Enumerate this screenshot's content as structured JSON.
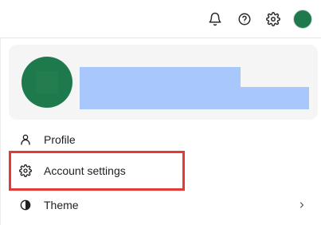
{
  "header": {
    "icons": [
      "bell-icon",
      "help-icon",
      "gear-icon",
      "avatar"
    ]
  },
  "user_card": {
    "redacted_name_color": "#a8c7fa",
    "avatar_color": "#1e7a4d"
  },
  "menu": {
    "items": [
      {
        "label": "Profile",
        "icon": "person-icon"
      },
      {
        "label": "Account settings",
        "icon": "gear-icon"
      },
      {
        "label": "Theme",
        "icon": "theme-icon",
        "has_submenu": true
      }
    ]
  },
  "highlight": {
    "color": "#e53935"
  }
}
